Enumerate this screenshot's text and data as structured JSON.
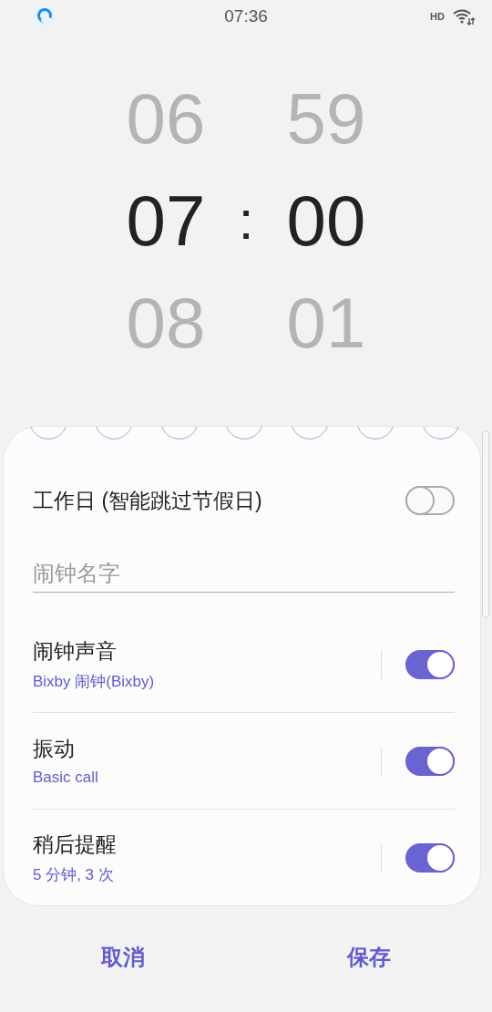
{
  "status_bar": {
    "time": "07:36",
    "network": "HD"
  },
  "time_picker": {
    "hours": [
      {
        "value": "06",
        "selected": false
      },
      {
        "value": "07",
        "selected": true
      },
      {
        "value": "08",
        "selected": false
      }
    ],
    "separator": ":",
    "minutes": [
      {
        "value": "59",
        "selected": false
      },
      {
        "value": "00",
        "selected": true
      },
      {
        "value": "01",
        "selected": false
      }
    ]
  },
  "workday": {
    "label": "工作日 (智能跳过节假日)",
    "on": false
  },
  "alarm_name": {
    "placeholder": "闹钟名字"
  },
  "settings": [
    {
      "title": "闹钟声音",
      "subtitle": "Bixby 闹钟(Bixby)",
      "on": true
    },
    {
      "title": "振动",
      "subtitle": "Basic call",
      "on": true
    },
    {
      "title": "稍后提醒",
      "subtitle": "5 分钟, 3 次",
      "on": true
    }
  ],
  "buttons": [
    {
      "label": "取消"
    },
    {
      "label": "保存"
    }
  ]
}
